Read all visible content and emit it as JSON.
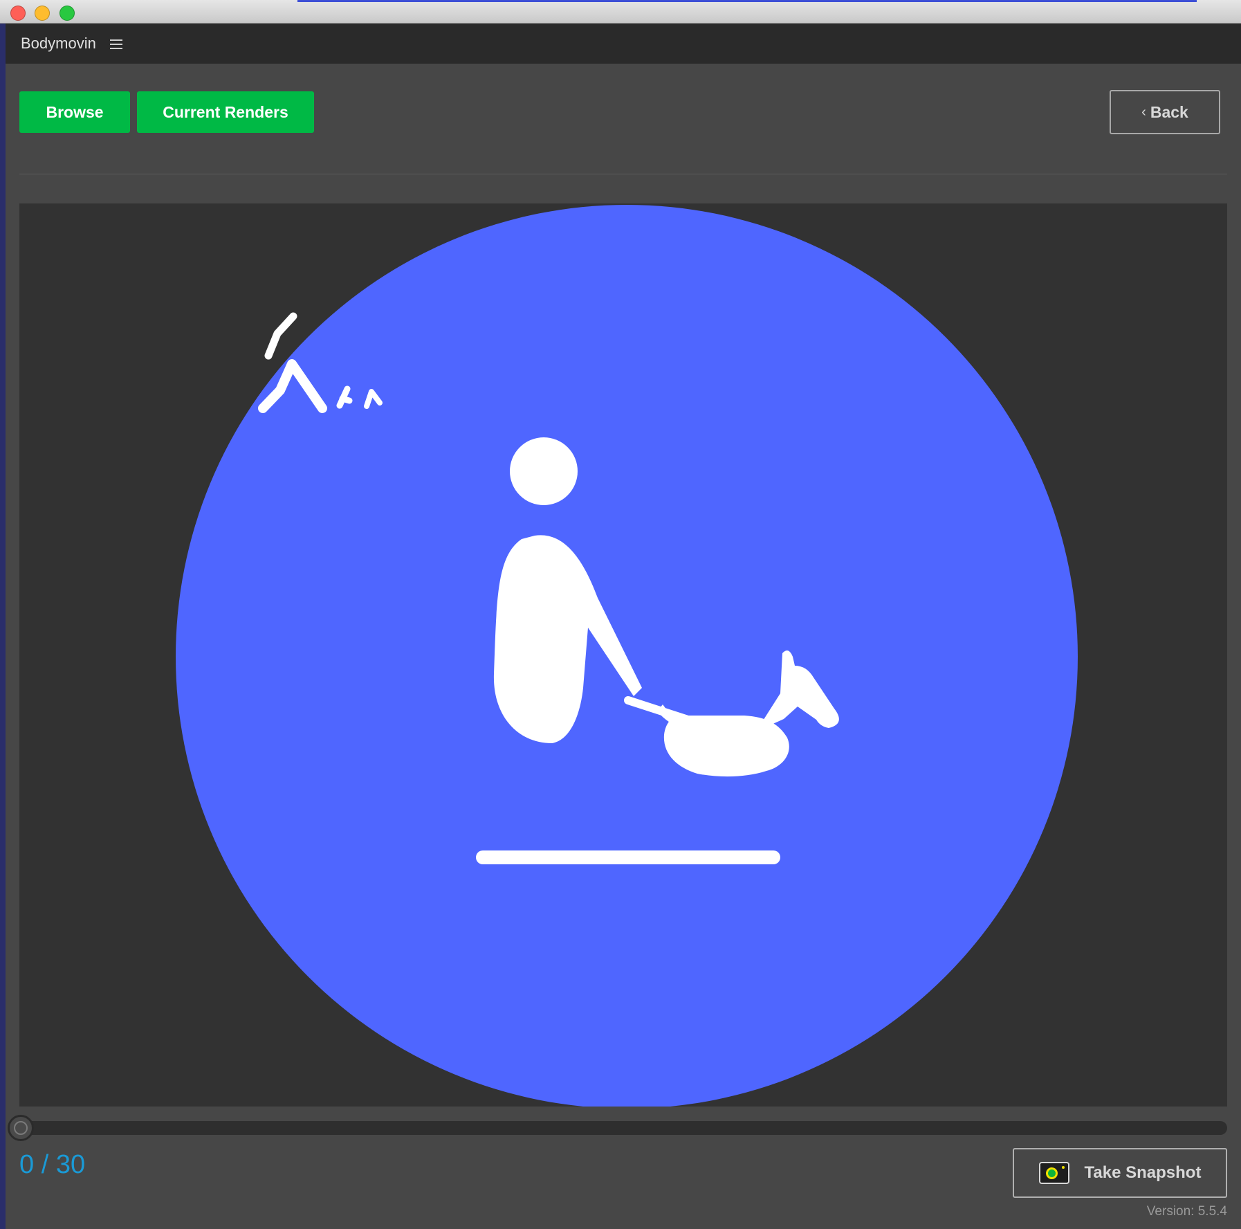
{
  "window": {
    "close_color": "#fe5f57",
    "minimize_color": "#febc2e",
    "maximize_color": "#28c840"
  },
  "panel": {
    "title": "Bodymovin",
    "menu_icon": "hamburger-menu-icon"
  },
  "toolbar": {
    "browse_label": "Browse",
    "current_renders_label": "Current Renders",
    "back_chevron": "‹",
    "back_label": "Back",
    "accent_color": "#00b945"
  },
  "preview": {
    "background_color": "#323232",
    "circle_color": "#4f66ff",
    "figure_color": "#ffffff",
    "scene": "person-pulling-dog-on-leash"
  },
  "timeline": {
    "current_frame": "0",
    "separator": " / ",
    "total_frames": "30",
    "progress": 0
  },
  "snapshot": {
    "label": "Take Snapshot",
    "icon": "camera-icon"
  },
  "footer": {
    "version": "Version: 5.5.4"
  }
}
